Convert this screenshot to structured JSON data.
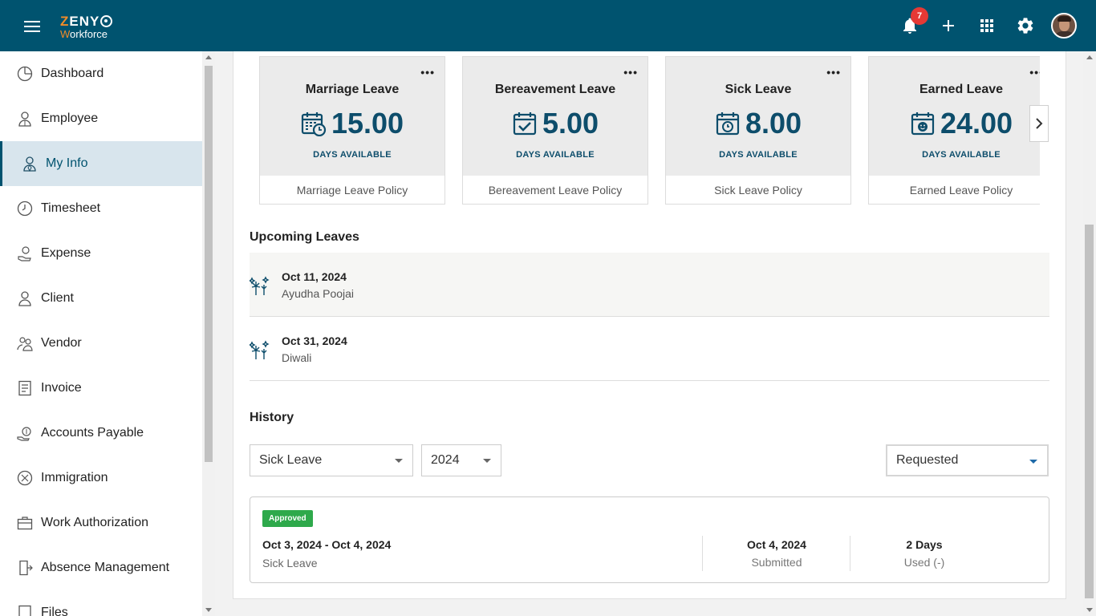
{
  "header": {
    "logo_top": "ZENYO",
    "logo_sub": "Workforce",
    "notification_count": "7"
  },
  "sidebar": {
    "items": [
      {
        "label": "Dashboard",
        "icon": "dashboard-icon"
      },
      {
        "label": "Employee",
        "icon": "employee-icon"
      },
      {
        "label": "My Info",
        "icon": "my-info-icon",
        "active": true
      },
      {
        "label": "Timesheet",
        "icon": "clock-icon"
      },
      {
        "label": "Expense",
        "icon": "expense-icon"
      },
      {
        "label": "Client",
        "icon": "client-icon"
      },
      {
        "label": "Vendor",
        "icon": "vendor-icon"
      },
      {
        "label": "Invoice",
        "icon": "invoice-icon"
      },
      {
        "label": "Accounts Payable",
        "icon": "accounts-payable-icon"
      },
      {
        "label": "Immigration",
        "icon": "immigration-icon"
      },
      {
        "label": "Work Authorization",
        "icon": "briefcase-icon"
      },
      {
        "label": "Absence Management",
        "icon": "exit-door-icon"
      },
      {
        "label": "Files",
        "icon": "file-icon"
      }
    ]
  },
  "leave_cards": [
    {
      "title": "Marriage Leave",
      "value": "15.00",
      "avail": "DAYS AVAILABLE",
      "policy": "Marriage Leave Policy",
      "icon": "calendar-clock-icon"
    },
    {
      "title": "Bereavement Leave",
      "value": "5.00",
      "avail": "DAYS AVAILABLE",
      "policy": "Bereavement Leave Policy",
      "icon": "calendar-check-icon"
    },
    {
      "title": "Sick Leave",
      "value": "8.00",
      "avail": "DAYS AVAILABLE",
      "policy": "Sick Leave Policy",
      "icon": "calendar-clock-icon"
    },
    {
      "title": "Earned Leave",
      "value": "24.00",
      "avail": "DAYS AVAILABLE",
      "policy": "Earned Leave Policy",
      "icon": "calendar-smile-icon"
    }
  ],
  "upcoming": {
    "title": "Upcoming Leaves",
    "items": [
      {
        "date": "Oct 11, 2024",
        "name": "Ayudha Poojai"
      },
      {
        "date": "Oct 31, 2024",
        "name": "Diwali"
      }
    ]
  },
  "history": {
    "title": "History",
    "filters": {
      "leave_type": "Sick Leave",
      "year": "2024",
      "status": "Requested"
    },
    "records": [
      {
        "status": "Approved",
        "range": "Oct 3, 2024 - Oct 4, 2024",
        "type": "Sick Leave",
        "submitted_date": "Oct 4, 2024",
        "submitted_label": "Submitted",
        "days": "2 Days",
        "days_label": "Used (-)"
      }
    ]
  },
  "colors": {
    "header": "#00536f",
    "accent": "#0d4d6b",
    "approved": "#2ea94b",
    "badge": "#e53935"
  }
}
